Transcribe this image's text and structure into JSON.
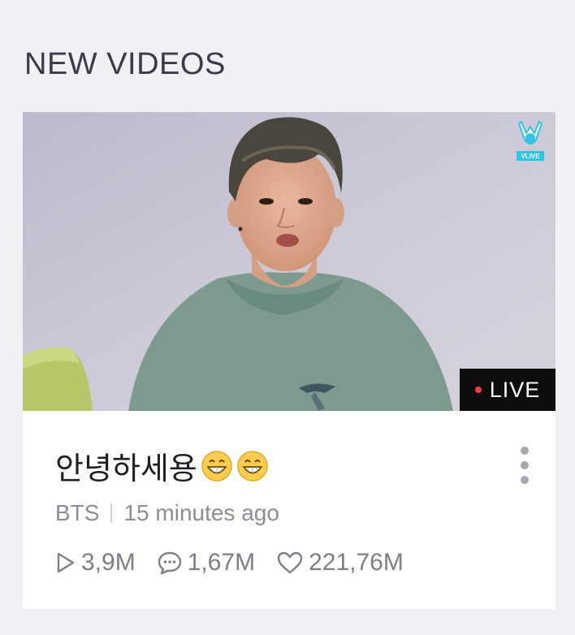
{
  "section": {
    "title": "NEW VIDEOS"
  },
  "video": {
    "title": "안녕하세용",
    "title_emoji": [
      "grinning-face-emoji",
      "grinning-face-emoji"
    ],
    "channel": "BTS",
    "posted": "15 minutes ago",
    "live_label": "LIVE",
    "logo_text": "VLIVE",
    "stats": {
      "plays": "3,9M",
      "comments": "1,67M",
      "likes": "221,76M"
    }
  },
  "icons": {
    "play": "play-icon",
    "comment": "comment-icon",
    "heart": "heart-icon",
    "more": "more-vertical-icon"
  },
  "colors": {
    "live_dot": "#ff3b3b",
    "badge_bg": "#0d0d0d",
    "logo_accent": "#2ec4e6"
  }
}
